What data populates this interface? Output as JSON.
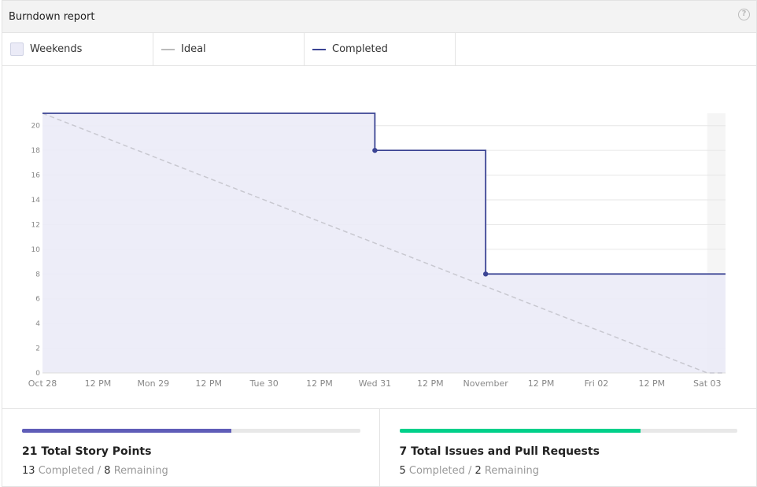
{
  "header": {
    "title": "Burndown report",
    "help_icon": "question-circle-icon"
  },
  "legend": {
    "weekends": "Weekends",
    "ideal": "Ideal",
    "completed": "Completed"
  },
  "colors": {
    "completed": "#3b4494",
    "area": "#ebebf7",
    "ideal": "#c8c8d0",
    "weekend": "#f5f5f5",
    "story_bar": "#5f5db8",
    "issues_bar": "#00d08a"
  },
  "chart_data": {
    "type": "line",
    "ylim": [
      0,
      21
    ],
    "yticks": [
      0,
      2,
      4,
      6,
      8,
      10,
      12,
      14,
      16,
      18,
      20
    ],
    "xticks": [
      "Oct 28",
      "12 PM",
      "Mon 29",
      "12 PM",
      "Tue 30",
      "12 PM",
      "Wed 31",
      "12 PM",
      "November",
      "12 PM",
      "Fri 02",
      "12 PM",
      "Sat 03"
    ],
    "xrange_halfdays": [
      0,
      12.33
    ],
    "weekend_shading": [
      [
        12,
        12.33
      ]
    ],
    "series": [
      {
        "name": "Ideal",
        "style": "dashed",
        "points": [
          [
            0,
            21
          ],
          [
            12,
            0
          ],
          [
            12.33,
            0
          ]
        ]
      },
      {
        "name": "Completed",
        "style": "step",
        "points": [
          [
            0,
            21
          ],
          [
            6,
            21
          ],
          [
            6,
            18
          ],
          [
            8,
            18
          ],
          [
            8,
            8
          ],
          [
            12.33,
            8
          ]
        ],
        "markers": [
          [
            6,
            18
          ],
          [
            8,
            8
          ]
        ]
      }
    ]
  },
  "stats": [
    {
      "title": "21 Total Story Points",
      "completed": "13",
      "completed_label": "Completed",
      "sep": "/",
      "remaining": "8",
      "remaining_label": "Remaining",
      "progress": 0.62
    },
    {
      "title": "7 Total Issues and Pull Requests",
      "completed": "5",
      "completed_label": "Completed",
      "sep": "/",
      "remaining": "2",
      "remaining_label": "Remaining",
      "progress": 0.714
    }
  ]
}
